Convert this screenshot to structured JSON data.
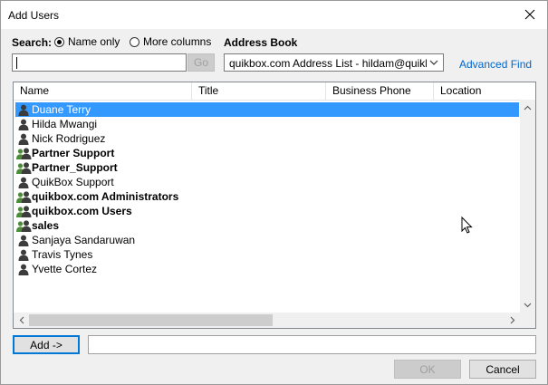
{
  "window": {
    "title": "Add Users"
  },
  "search": {
    "label": "Search:",
    "option_name_only": "Name only",
    "option_more_columns": "More columns",
    "selected": "Name only",
    "input_value": "",
    "go_label": "Go"
  },
  "address_book": {
    "label": "Address Book",
    "selected": "quikbox.com Address List - hildam@quikbox",
    "advanced_find": "Advanced Find"
  },
  "table": {
    "columns": [
      "Name",
      "Title",
      "Business Phone",
      "Location"
    ],
    "rows": [
      {
        "name": "Duane Terry",
        "icon": "user-icon",
        "bold": false,
        "selected": true
      },
      {
        "name": "Hilda Mwangi",
        "icon": "user-icon",
        "bold": false,
        "selected": false
      },
      {
        "name": "Nick Rodriguez",
        "icon": "user-icon",
        "bold": false,
        "selected": false
      },
      {
        "name": "Partner Support",
        "icon": "group-icon",
        "bold": true,
        "selected": false
      },
      {
        "name": "Partner_Support",
        "icon": "group-icon",
        "bold": true,
        "selected": false
      },
      {
        "name": "QuikBox Support",
        "icon": "user-icon",
        "bold": false,
        "selected": false
      },
      {
        "name": "quikbox.com Administrators",
        "icon": "group-icon",
        "bold": true,
        "selected": false
      },
      {
        "name": "quikbox.com Users",
        "icon": "group-icon",
        "bold": true,
        "selected": false
      },
      {
        "name": "sales",
        "icon": "group-icon",
        "bold": true,
        "selected": false
      },
      {
        "name": "Sanjaya Sandaruwan",
        "icon": "user-icon",
        "bold": false,
        "selected": false
      },
      {
        "name": "Travis Tynes",
        "icon": "user-icon",
        "bold": false,
        "selected": false
      },
      {
        "name": "Yvette Cortez",
        "icon": "user-icon",
        "bold": false,
        "selected": false
      }
    ]
  },
  "add": {
    "button_label": "Add ->",
    "field_value": ""
  },
  "footer": {
    "ok_label": "OK",
    "cancel_label": "Cancel"
  },
  "colors": {
    "selection": "#3399ff",
    "link": "#0066cc",
    "focus": "#0078d7"
  }
}
